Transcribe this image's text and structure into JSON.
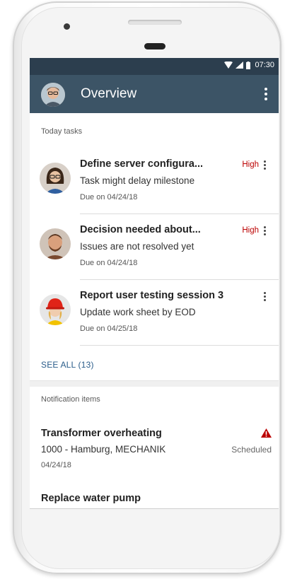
{
  "status_bar": {
    "time": "07:30"
  },
  "app_bar": {
    "title": "Overview"
  },
  "today_tasks": {
    "label": "Today tasks",
    "items": [
      {
        "title": "Define server configura...",
        "subtitle": "Task might delay milestone",
        "due": "Due on 04/24/18",
        "priority": "High"
      },
      {
        "title": "Decision needed about...",
        "subtitle": "Issues are not resolved yet",
        "due": "Due on 04/24/18",
        "priority": "High"
      },
      {
        "title": "Report user testing session 3",
        "subtitle": "Update work sheet by EOD",
        "due": "Due on 04/25/18",
        "priority": ""
      }
    ],
    "see_all": "SEE ALL (13)"
  },
  "notifications": {
    "label": "Notification items",
    "items": [
      {
        "title": "Transformer overheating",
        "subtitle": "1000 - Hamburg, MECHANIK",
        "date": "04/24/18",
        "status": "Scheduled",
        "icon": "warning-icon"
      },
      {
        "title": "Replace water pump"
      }
    ]
  },
  "colors": {
    "statusbar": "#2c3e4e",
    "appbar": "#3c5466",
    "priority": "#bb0000",
    "link": "#2a5c8a",
    "warning": "#bb0000"
  }
}
